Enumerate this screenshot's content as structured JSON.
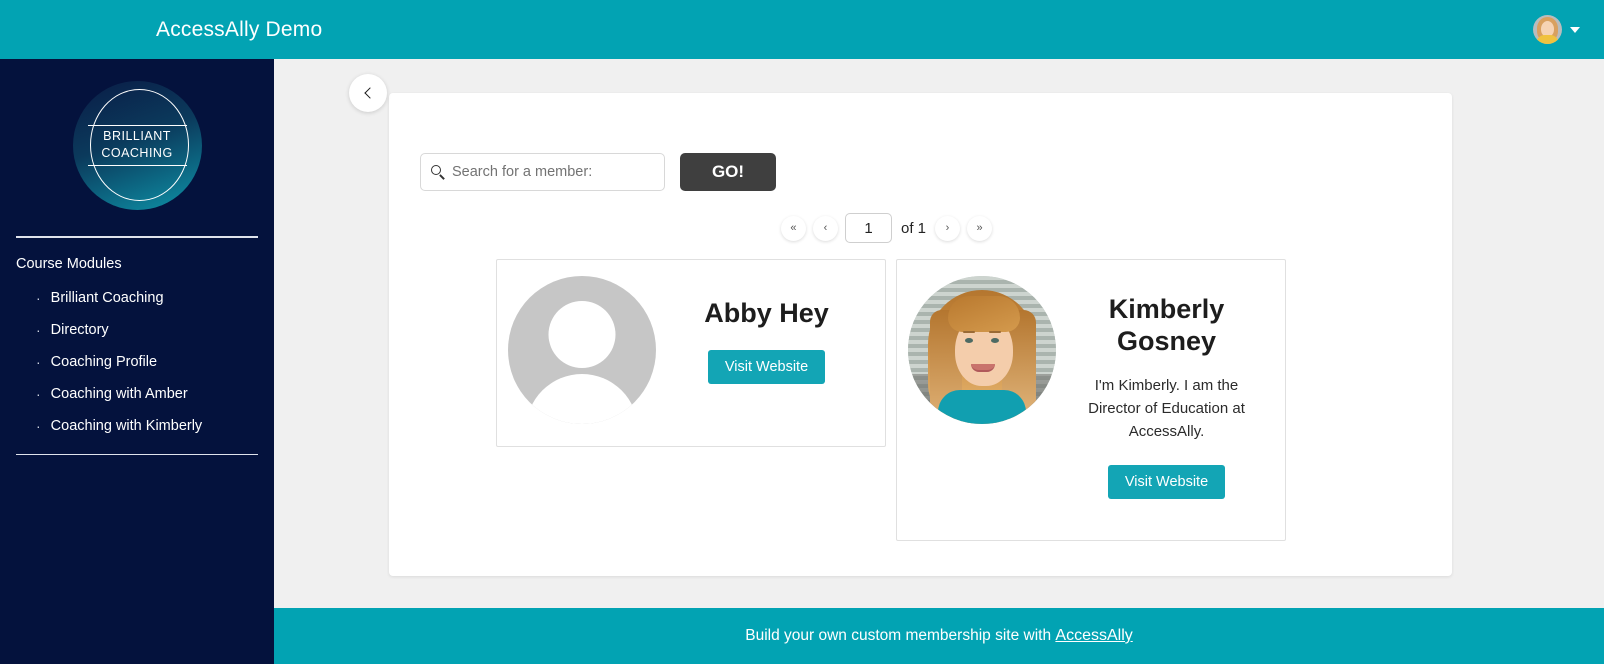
{
  "header": {
    "title": "AccessAlly Demo",
    "avatar_icon": "user-avatar",
    "caret_icon": "caret-down-icon"
  },
  "sidebar": {
    "logo": {
      "line1": "BRILLIANT",
      "line2": "COACHING"
    },
    "section_title": "Course Modules",
    "items": [
      {
        "label": "Brilliant Coaching",
        "bullet": "·"
      },
      {
        "label": "Directory",
        "bullet": "·"
      },
      {
        "label": "Coaching Profile",
        "bullet": "·"
      },
      {
        "label": "Coaching with Amber",
        "bullet": "·"
      },
      {
        "label": "Coaching with Kimberly",
        "bullet": "·"
      }
    ]
  },
  "main": {
    "collapse_icon": "chevron-left-icon",
    "search": {
      "icon": "search-icon",
      "placeholder": "Search for a member:",
      "value": "",
      "button_label": "GO!"
    },
    "pagination": {
      "first_label": "«",
      "prev_label": "‹",
      "page_value": "1",
      "of_label": "of 1",
      "next_label": "›",
      "last_label": "»"
    },
    "members": [
      {
        "name": "Abby Hey",
        "bio": "",
        "button_label": "Visit Website",
        "avatar_type": "placeholder-avatar-icon"
      },
      {
        "name": "Kimberly Gosney",
        "bio": "I'm Kimberly. I am the Director of Education at AccessAlly.",
        "button_label": "Visit Website",
        "avatar_type": "member-photo"
      }
    ]
  },
  "footer": {
    "text": "Build your own custom membership site with",
    "link_label": "AccessAlly"
  },
  "colors": {
    "teal": "#02a3b3",
    "navy": "#04123d",
    "button_dark": "#3f3f3f",
    "accent_button": "#13a5b5",
    "page_bg": "#f0f0f0"
  }
}
